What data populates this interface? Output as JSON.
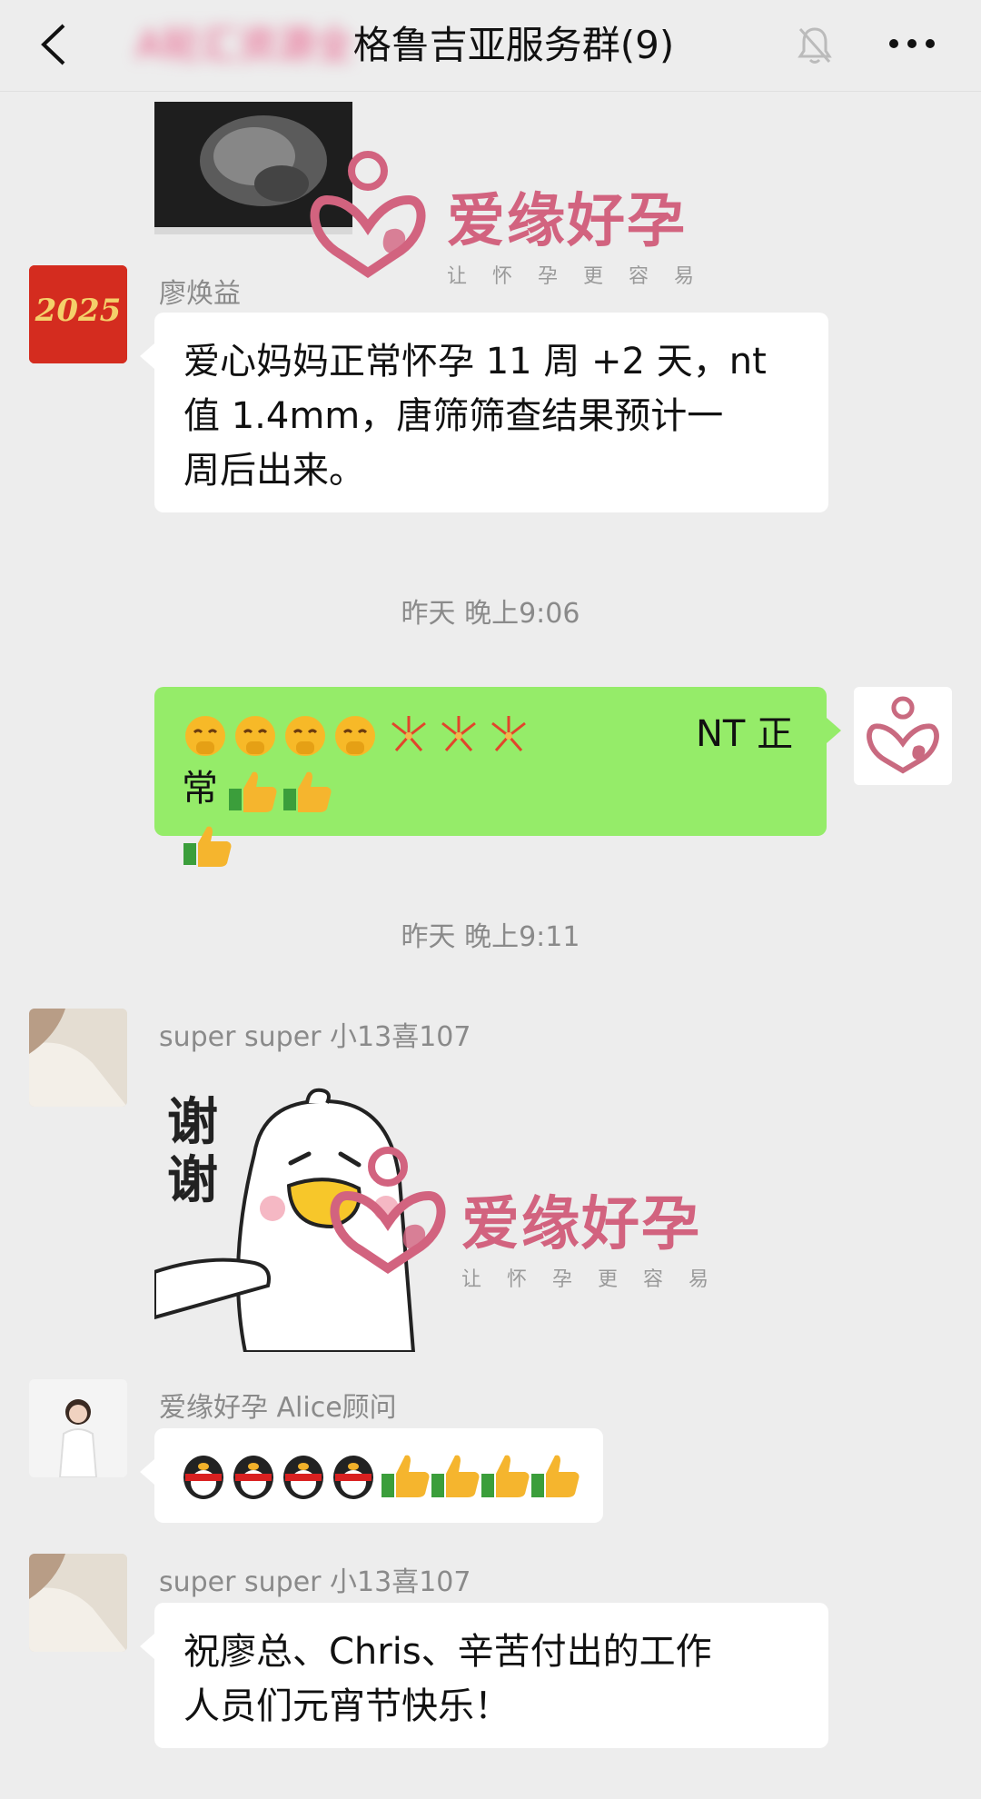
{
  "header": {
    "title_blurred": "A轮汇资源全",
    "title_visible": "格鲁吉亚服务群(9)"
  },
  "watermark": {
    "brand": "爱缘好孕",
    "slogan": "让怀孕更容易"
  },
  "messages": [
    {
      "sender": "廖焕益",
      "avatar_text": "2025",
      "text_line1": "爱心妈妈正常怀孕 11 周 +2 天，nt",
      "text_line2": "值 1.4mm，唐筛筛查结果预计一",
      "text_line3": "周后出来。"
    },
    {
      "time": "昨天 晚上9:06"
    },
    {
      "self": true,
      "text": "NT 正常"
    },
    {
      "time": "昨天 晚上9:11"
    },
    {
      "sender": "super super 小13喜107",
      "sticker_text_1": "谢",
      "sticker_text_2": "谢"
    },
    {
      "sender": "爱缘好孕 Alice顾问"
    },
    {
      "sender": "super super 小13喜107",
      "text_line1": "祝廖总、Chris、辛苦付出的工作",
      "text_line2": "人员们元宵节快乐！"
    }
  ]
}
